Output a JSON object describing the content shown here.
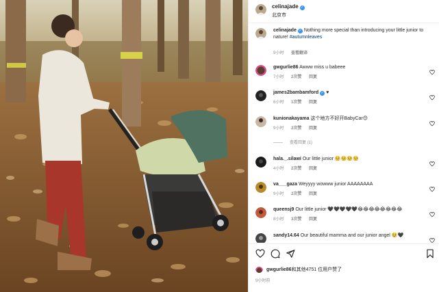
{
  "post": {
    "author": "celinajade",
    "location": "北京市"
  },
  "caption": {
    "username": "celinajade",
    "text": "Nothing more special than introducing your little junior to nature!",
    "hashtag": "#autumnleaves",
    "time": "9小时",
    "translate": "查看翻译"
  },
  "comments": [
    {
      "username": "gwgurlie86",
      "text": "Awww miss u babeee",
      "time": "7小时",
      "likes": "2次赞",
      "reply": "回复"
    },
    {
      "username": "james2bambamford",
      "text": "♥",
      "time": "6小时",
      "likes": "1次赞",
      "reply": "回复"
    },
    {
      "username": "kunionakayama",
      "text": "这个地方不好开BabyCar😊",
      "time": "9小时",
      "likes": "2次赞",
      "reply": "回复",
      "view_replies": "查看回复 (1)"
    },
    {
      "username": "hala._.silawi",
      "text": "Our little junior 🥺🥺🥺🥺",
      "time": "4小时",
      "likes": "2次赞",
      "reply": "回复"
    },
    {
      "username": "va___gaza",
      "text": "Weyyyy wowww junior AAAAAAAA",
      "time": "9小时",
      "likes": "2次赞",
      "reply": "回复"
    },
    {
      "username": "queensj9",
      "text": "Our little junior 🖤🖤🖤🖤🖤😂😂😂😂😂😂😂😂",
      "time": "8小时",
      "likes": "3次赞",
      "reply": "回复"
    },
    {
      "username": "sandy14.64",
      "text": "Our beautiful mamma and our junior angel 🥹🖤",
      "time": "",
      "likes": "",
      "reply": ""
    }
  ],
  "footer": {
    "liked_by_user": "gwgurlie86",
    "liked_by_rest": "和其他4751 位用户赞了",
    "time": "9小时前"
  },
  "icons": {
    "like": "heart-icon",
    "comment": "comment-icon",
    "share": "send-icon",
    "save": "bookmark-icon"
  },
  "colors": {
    "verified": "#3897f0",
    "hashtag": "#00376b",
    "meta": "#8e8e8e"
  }
}
